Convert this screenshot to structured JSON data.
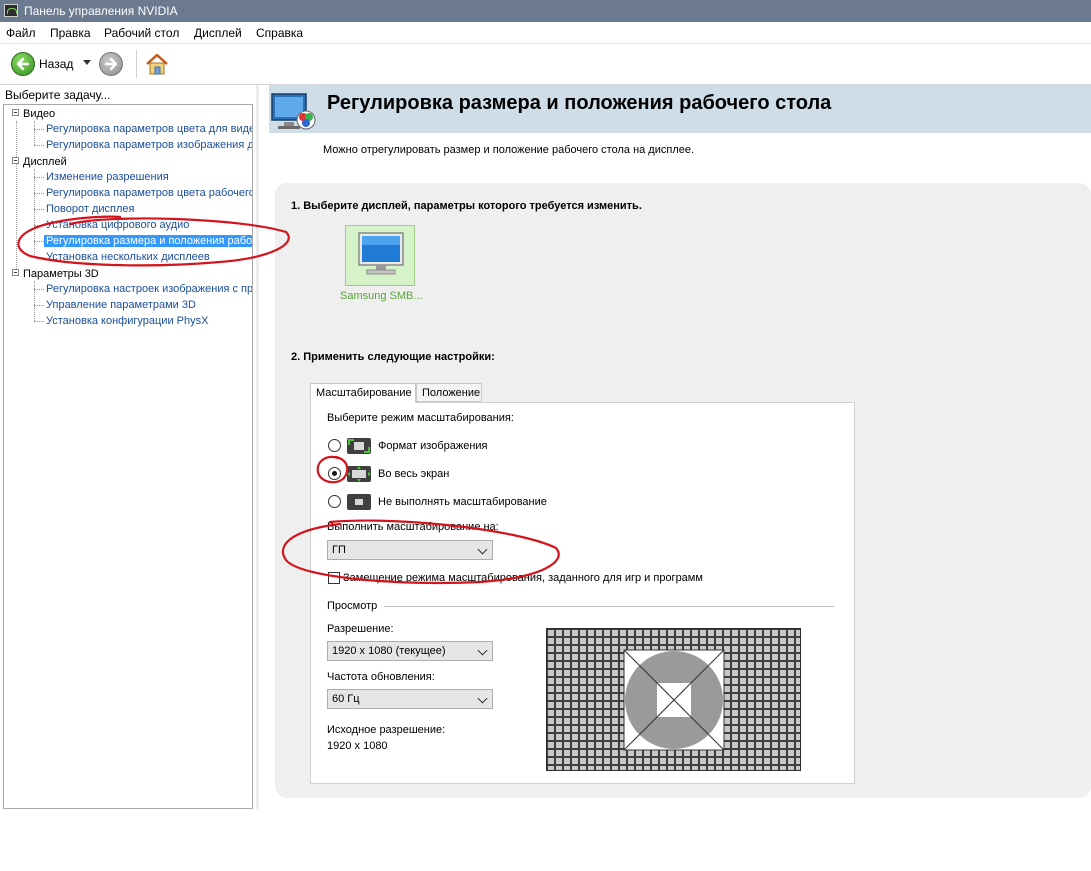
{
  "window": {
    "title": "Панель управления NVIDIA",
    "icon": "nvidia-app-icon"
  },
  "menu": {
    "items": [
      "Файл",
      "Правка",
      "Рабочий стол",
      "Дисплей",
      "Справка"
    ]
  },
  "toolbar": {
    "back_label": "Назад",
    "icons": [
      "back-arrow-icon",
      "dropdown-caret-icon",
      "forward-arrow-icon",
      "home-icon"
    ]
  },
  "tasks": {
    "header": "Выберите задачу...",
    "groups": [
      {
        "label": "Видео",
        "items": [
          "Регулировка параметров цвета для видео",
          "Регулировка параметров изображения для видео"
        ]
      },
      {
        "label": "Дисплей",
        "items": [
          "Изменение разрешения",
          "Регулировка параметров цвета рабочего стола",
          "Поворот дисплея",
          "Установка цифрового аудио",
          "Регулировка размера и положения рабочего стола",
          "Установка нескольких дисплеев"
        ]
      },
      {
        "label": "Параметры 3D",
        "items": [
          "Регулировка настроек изображения с просмотром",
          "Управление параметрами 3D",
          "Установка конфигурации PhysX"
        ]
      }
    ],
    "selected": "Регулировка размера и положения рабочего стола"
  },
  "page": {
    "title": "Регулировка размера и положения рабочего стола",
    "description": "Можно отрегулировать размер и положение рабочего стола на дисплее.",
    "step1": "1. Выберите дисплей, параметры которого требуется изменить.",
    "display_label": "Samsung SMB...",
    "step2": "2. Применить следующие настройки:"
  },
  "tabs": {
    "scaling": "Масштабирование",
    "position": "Положение",
    "active": "Масштабирование"
  },
  "scaling": {
    "mode_prompt": "Выберите режим масштабирования:",
    "mode_aspect": "Формат изображения",
    "mode_full": "Во весь экран",
    "mode_none": "Не выполнять масштабирование",
    "selected_mode": "Во весь экран",
    "perform_on_label": "Выполнить масштабирование на:",
    "perform_on_value": "ГП",
    "override_label": "Замещение режима масштабирования, заданного для игр и программ",
    "override_checked": false
  },
  "preview": {
    "section": "Просмотр",
    "resolution_label": "Разрешение:",
    "resolution_value": "1920 x 1080 (текущее)",
    "refresh_label": "Частота обновления:",
    "refresh_value": "60 Гц",
    "native_label": "Исходное разрешение:",
    "native_value": "1920 x 1080"
  },
  "colors": {
    "titlebar": "#6b7a8f",
    "selection": "#3399ff",
    "link": "#1b4e9b",
    "header_band": "#cfdde8",
    "annotation": "#d4141c"
  }
}
